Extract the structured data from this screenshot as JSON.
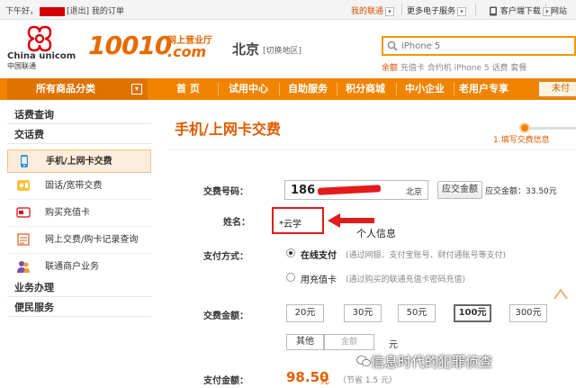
{
  "topbar": {
    "greeting": "下午好，",
    "logout": "[退出]",
    "my_orders": "我的订单",
    "my_unicom": "我的联通",
    "more_services": "更多电子服务",
    "client_download": "客户端下载",
    "website": "网站"
  },
  "header": {
    "logo_brand": "China unicom",
    "logo_cn": "中国联通",
    "hotline": "10010",
    "hotline_sub": "网上营业厅",
    "hotline_com": ".com",
    "city": "北京",
    "switch_area": "[切换地区]",
    "search_placeholder": "iPhone 5",
    "hot_words": [
      "余额",
      "充值卡",
      "合约机",
      "iPhone 5",
      "话费",
      "套餐"
    ]
  },
  "nav": {
    "category": "所有商品分类",
    "items": [
      "首  页",
      "试用中心",
      "自助服务",
      "积分商城",
      "中小企业",
      "老用户专享"
    ],
    "not_done": "未付"
  },
  "sidebar": {
    "section1": "话费查询",
    "section2": "交话费",
    "items": [
      {
        "label": "手机/上网卡交费",
        "icon": "phone-icon"
      },
      {
        "label": "固话/宽带交费",
        "icon": "landline-icon"
      },
      {
        "label": "购买充值卡",
        "icon": "card-icon"
      },
      {
        "label": "网上交费/购卡记录查询",
        "icon": "record-icon"
      },
      {
        "label": "联通商户业务",
        "icon": "merchant-icon"
      }
    ],
    "section3": "业务办理",
    "section4": "便民服务"
  },
  "main": {
    "title": "手机/上网卡交费",
    "step1": "1.填写交费信息",
    "phone_label": "交费号码：",
    "phone_prefix": "186",
    "phone_location": "北京",
    "query_balance_btn": "应交金额",
    "balance_text": "应交金额：33.50元",
    "name_label": "姓名：",
    "name_value": "*云学",
    "annotation": "个人信息",
    "pay_method_label": "支付方式：",
    "pay_online": "在线支付",
    "pay_online_note": "(通过网银、支付宝账号、财付通账号等支付)",
    "pay_card": "用充值卡",
    "pay_card_note": "(通过购买的联通充值卡密码充值)",
    "amount_label": "交费金额：",
    "amounts": [
      "20元",
      "30元",
      "50元",
      "100元",
      "300元"
    ],
    "selected_amount": "100元",
    "other": "其他",
    "other_placeholder": "金额",
    "yuan": "元",
    "pay_total_label": "支付金额：",
    "pay_total": "98.50",
    "pay_unit": "元",
    "pay_save": "（节省 1.5 元）"
  },
  "watermark": "信息时代的犯罪侦查",
  "colors": {
    "accent": "#f08300",
    "title": "#e05a00",
    "highlight": "#e31b1b"
  }
}
